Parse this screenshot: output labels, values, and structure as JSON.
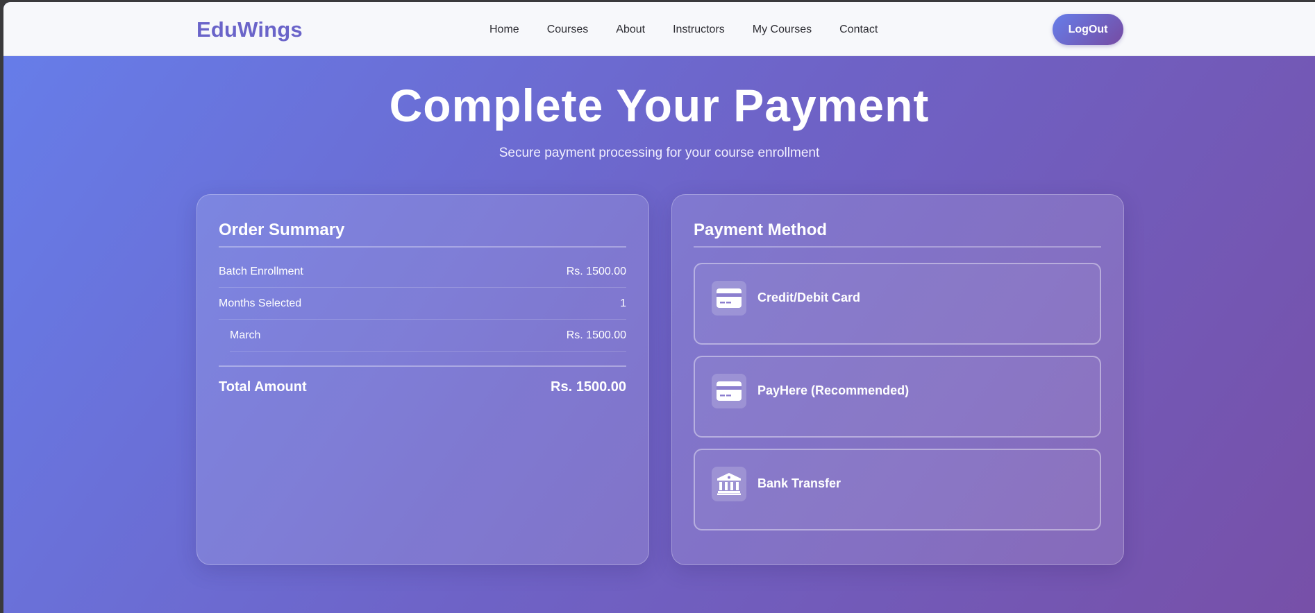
{
  "nav": {
    "brand": "EduWings",
    "links": [
      "Home",
      "Courses",
      "About",
      "Instructors",
      "My Courses",
      "Contact"
    ],
    "logout_label": "LogOut"
  },
  "hero": {
    "title": "Complete Your Payment",
    "subtitle": "Secure payment processing for your course enrollment"
  },
  "summary": {
    "title": "Order Summary",
    "rows": [
      {
        "label": "Batch Enrollment",
        "value": "Rs. 1500.00"
      },
      {
        "label": "Months Selected",
        "value": "1"
      },
      {
        "label": "March",
        "value": "Rs. 1500.00"
      }
    ],
    "total_label": "Total Amount",
    "total_value": "Rs. 1500.00"
  },
  "payment": {
    "title": "Payment Method",
    "methods": [
      {
        "label": "Credit/Debit Card",
        "icon": "credit-card-icon"
      },
      {
        "label": "PayHere (Recommended)",
        "icon": "credit-card-icon"
      },
      {
        "label": "Bank Transfer",
        "icon": "bank-icon"
      }
    ]
  },
  "colors": {
    "brand": "#6a64c9",
    "gradient_start": "#667eea",
    "gradient_end": "#764ba2"
  }
}
